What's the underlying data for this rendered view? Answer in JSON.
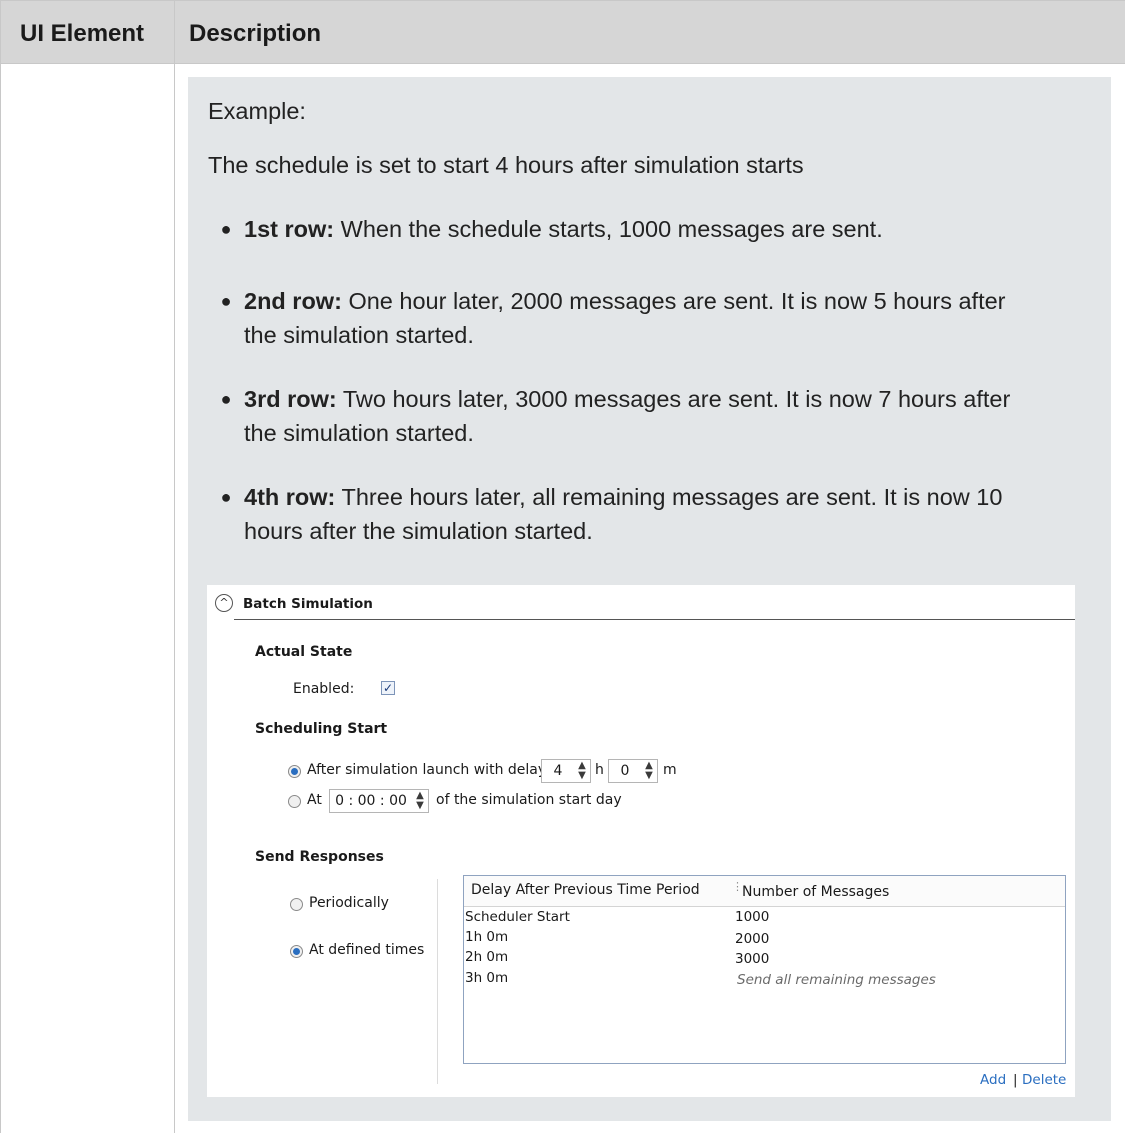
{
  "table": {
    "header": {
      "col1": "UI Element",
      "col2": "Description"
    }
  },
  "example": {
    "heading": "Example:",
    "intro": "The schedule is set to start 4 hours after simulation starts",
    "bullets": [
      {
        "label": "1st row:",
        "text": " When the schedule starts, 1000 messages are sent.",
        "line2": ""
      },
      {
        "label": "2nd row:",
        "text": " One hour later, 2000 messages are sent. It is now 5 hours after",
        "line2": "the simulation started."
      },
      {
        "label": "3rd row:",
        "text": " Two hours later, 3000 messages are sent. It is now 7 hours after",
        "line2": "the simulation started."
      },
      {
        "label": "4th row:",
        "text": " Three hours later, all remaining messages are sent. It is now 10",
        "line2": "hours after the simulation started."
      }
    ]
  },
  "screenshot": {
    "section_title": "Batch Simulation",
    "actual_state": {
      "heading": "Actual State",
      "enabled_label": "Enabled:",
      "enabled_checked": "✓"
    },
    "scheduling_start": {
      "heading": "Scheduling Start",
      "option_delay_label": "After simulation launch with delay",
      "hours_value": "4",
      "hours_unit": "h",
      "minutes_value": "0",
      "minutes_unit": "m",
      "option_at_label": "At",
      "at_time_value": "0 : 00 : 00",
      "at_suffix": "of the simulation start day"
    },
    "send_responses": {
      "heading": "Send Responses",
      "option_periodically": "Periodically",
      "option_defined_times": "At defined times",
      "grid": {
        "columns": [
          "Delay After Previous Time Period",
          "Number of Messages"
        ],
        "rows": [
          [
            "Scheduler Start",
            "1000"
          ],
          [
            "1h 0m",
            "2000"
          ],
          [
            "2h 0m",
            "3000"
          ],
          [
            "3h 0m",
            "Send all remaining messages"
          ]
        ]
      },
      "add_link": "Add",
      "link_separator": "|",
      "delete_link": "Delete"
    }
  },
  "colors": {
    "example_background": "#e3e6e8",
    "header_background": "#d6d6d6",
    "link": "#2a6ec0"
  }
}
